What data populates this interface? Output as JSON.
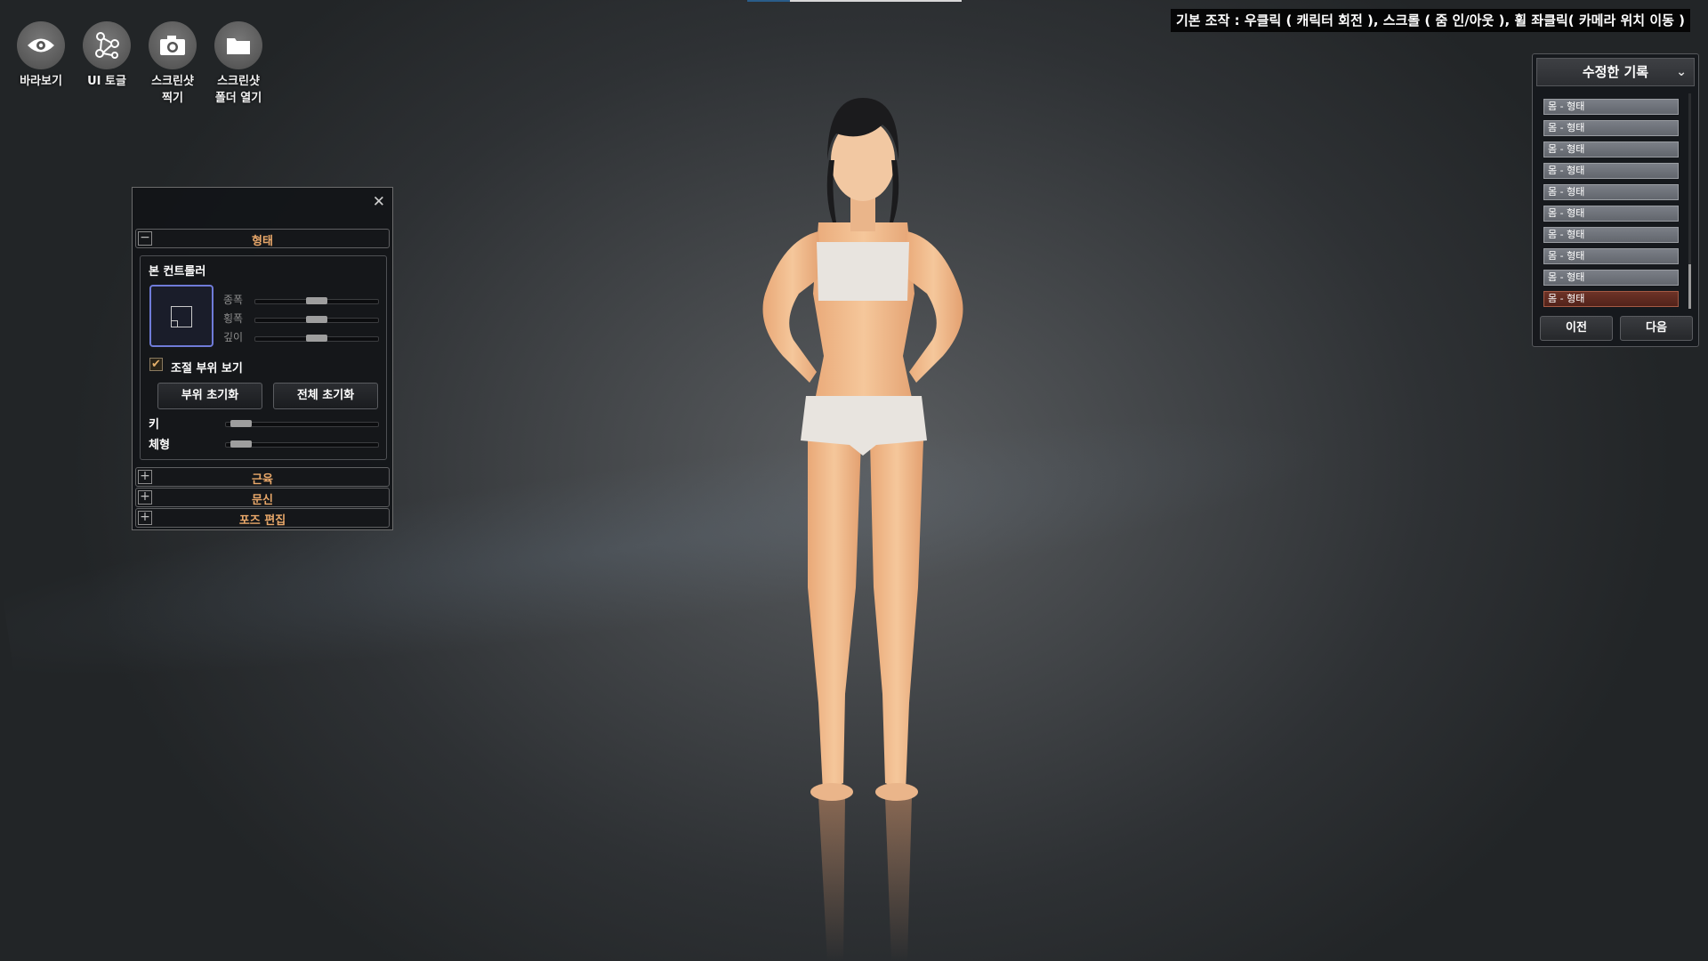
{
  "toolbar": {
    "items": [
      {
        "label": "바라보기",
        "icon": "eye-icon"
      },
      {
        "label": "UI 토글",
        "icon": "nodes-icon"
      },
      {
        "label": "스크린샷\n찍기",
        "icon": "camera-icon"
      },
      {
        "label": "스크린샷\n폴더 열기",
        "icon": "folder-icon"
      }
    ]
  },
  "help_text": "기본 조작 : 우클릭 ( 캐릭터 회전 ), 스크롤 ( 줌 인/아웃 ), 휠 좌클릭( 카메라 위치 이동 )",
  "editor": {
    "sections": {
      "shape": "형태",
      "muscle": "근육",
      "tattoo": "문신",
      "pose": "포즈 편집"
    },
    "bone_controller": {
      "title": "본 컨트롤러",
      "sliders": [
        {
          "label": "종폭",
          "value": 0.5
        },
        {
          "label": "횡폭",
          "value": 0.5
        },
        {
          "label": "깊이",
          "value": 0.5
        }
      ],
      "show_region_label": "조절 부위 보기",
      "show_region_checked": true,
      "reset_part_label": "부위 초기화",
      "reset_all_label": "전체 초기화",
      "height": {
        "label": "키",
        "value": 0.1
      },
      "body_type": {
        "label": "체형",
        "value": 0.1
      }
    }
  },
  "history": {
    "title": "수정한 기록",
    "items": [
      "몸 - 형태",
      "몸 - 형태",
      "몸 - 형태",
      "몸 - 형태",
      "몸 - 형태",
      "몸 - 형태",
      "몸 - 형태",
      "몸 - 형태",
      "몸 - 형태",
      "몸 - 형태"
    ],
    "active_index": 9,
    "prev_label": "이전",
    "next_label": "다음"
  },
  "colors": {
    "section_title": "#e9a86a",
    "active_history": "#6d3327",
    "bone_box_border": "#6f7bd8"
  }
}
